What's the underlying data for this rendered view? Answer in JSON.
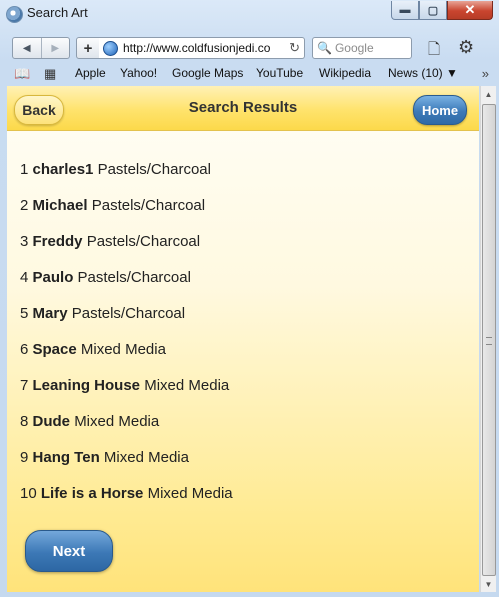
{
  "window": {
    "title": "Search Art",
    "controls": {
      "minimize": "▬",
      "maximize": "▢",
      "close": "✕"
    }
  },
  "toolbar": {
    "back_icon": "◀",
    "forward_icon": "▶",
    "add_icon": "+",
    "url": "http://www.coldfusionjedi.co",
    "reload_icon": "↻",
    "search_icon": "🔍",
    "search_placeholder": "Google",
    "page_icon": "🗋",
    "gear_icon": "⚙"
  },
  "bookmarks": {
    "book_icon": "📖",
    "grid_icon": "▦",
    "items": [
      "Apple",
      "Yahoo!",
      "Google Maps",
      "YouTube",
      "Wikipedia",
      "News (10) ▼"
    ],
    "more_icon": "»"
  },
  "page": {
    "back_label": "Back",
    "title": "Search Results",
    "home_label": "Home",
    "results": [
      {
        "num": "1",
        "name": "charles1",
        "medium": "Pastels/Charcoal"
      },
      {
        "num": "2",
        "name": "Michael",
        "medium": "Pastels/Charcoal"
      },
      {
        "num": "3",
        "name": "Freddy",
        "medium": "Pastels/Charcoal"
      },
      {
        "num": "4",
        "name": "Paulo",
        "medium": "Pastels/Charcoal"
      },
      {
        "num": "5",
        "name": "Mary",
        "medium": "Pastels/Charcoal"
      },
      {
        "num": "6",
        "name": "Space",
        "medium": "Mixed Media"
      },
      {
        "num": "7",
        "name": "Leaning House",
        "medium": "Mixed Media"
      },
      {
        "num": "8",
        "name": "Dude",
        "medium": "Mixed Media"
      },
      {
        "num": "9",
        "name": "Hang Ten",
        "medium": "Mixed Media"
      },
      {
        "num": "10",
        "name": "Life is a Horse",
        "medium": "Mixed Media"
      }
    ],
    "next_label": "Next"
  },
  "scrollbar": {
    "up_icon": "▲",
    "down_icon": "▼"
  }
}
